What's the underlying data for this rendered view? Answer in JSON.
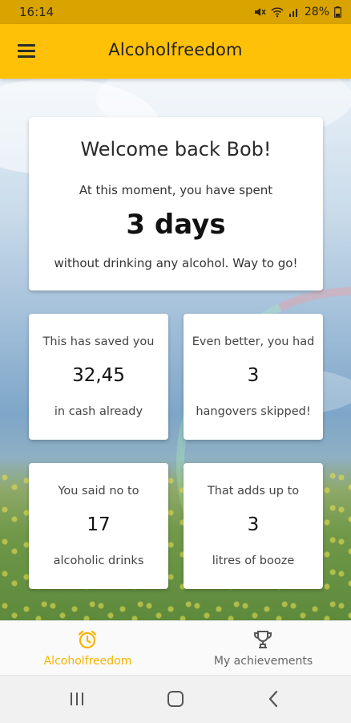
{
  "status_bar": {
    "time": "16:14",
    "battery": "28%",
    "icons": [
      "mute-icon",
      "wifi-icon",
      "signal-icon",
      "battery-icon"
    ]
  },
  "app_bar": {
    "title": "Alcoholfreedom",
    "menu_icon": "menu-icon",
    "accent_color": "#ffc107"
  },
  "welcome": {
    "title": "Welcome back Bob!",
    "subtitle": "At this moment, you have spent",
    "days": "3 days",
    "footer": "without drinking any alcohol. Way to go!"
  },
  "stats": [
    {
      "top": "This has saved you",
      "value": "32,45",
      "bottom": "in cash already"
    },
    {
      "top": "Even better, you had",
      "value": "3",
      "bottom": "hangovers skipped!"
    },
    {
      "top": "You said no to",
      "value": "17",
      "bottom": "alcoholic drinks"
    },
    {
      "top": "That adds up to",
      "value": "3",
      "bottom": "litres of booze"
    }
  ],
  "bottom_nav": {
    "items": [
      {
        "label": "Alcoholfreedom",
        "icon": "alarm-clock-icon",
        "active": true
      },
      {
        "label": "My achievements",
        "icon": "trophy-icon",
        "active": false
      }
    ],
    "active_color": "#f5b400"
  },
  "system_nav": {
    "buttons": [
      "recent-apps-icon",
      "home-icon",
      "back-icon"
    ]
  }
}
